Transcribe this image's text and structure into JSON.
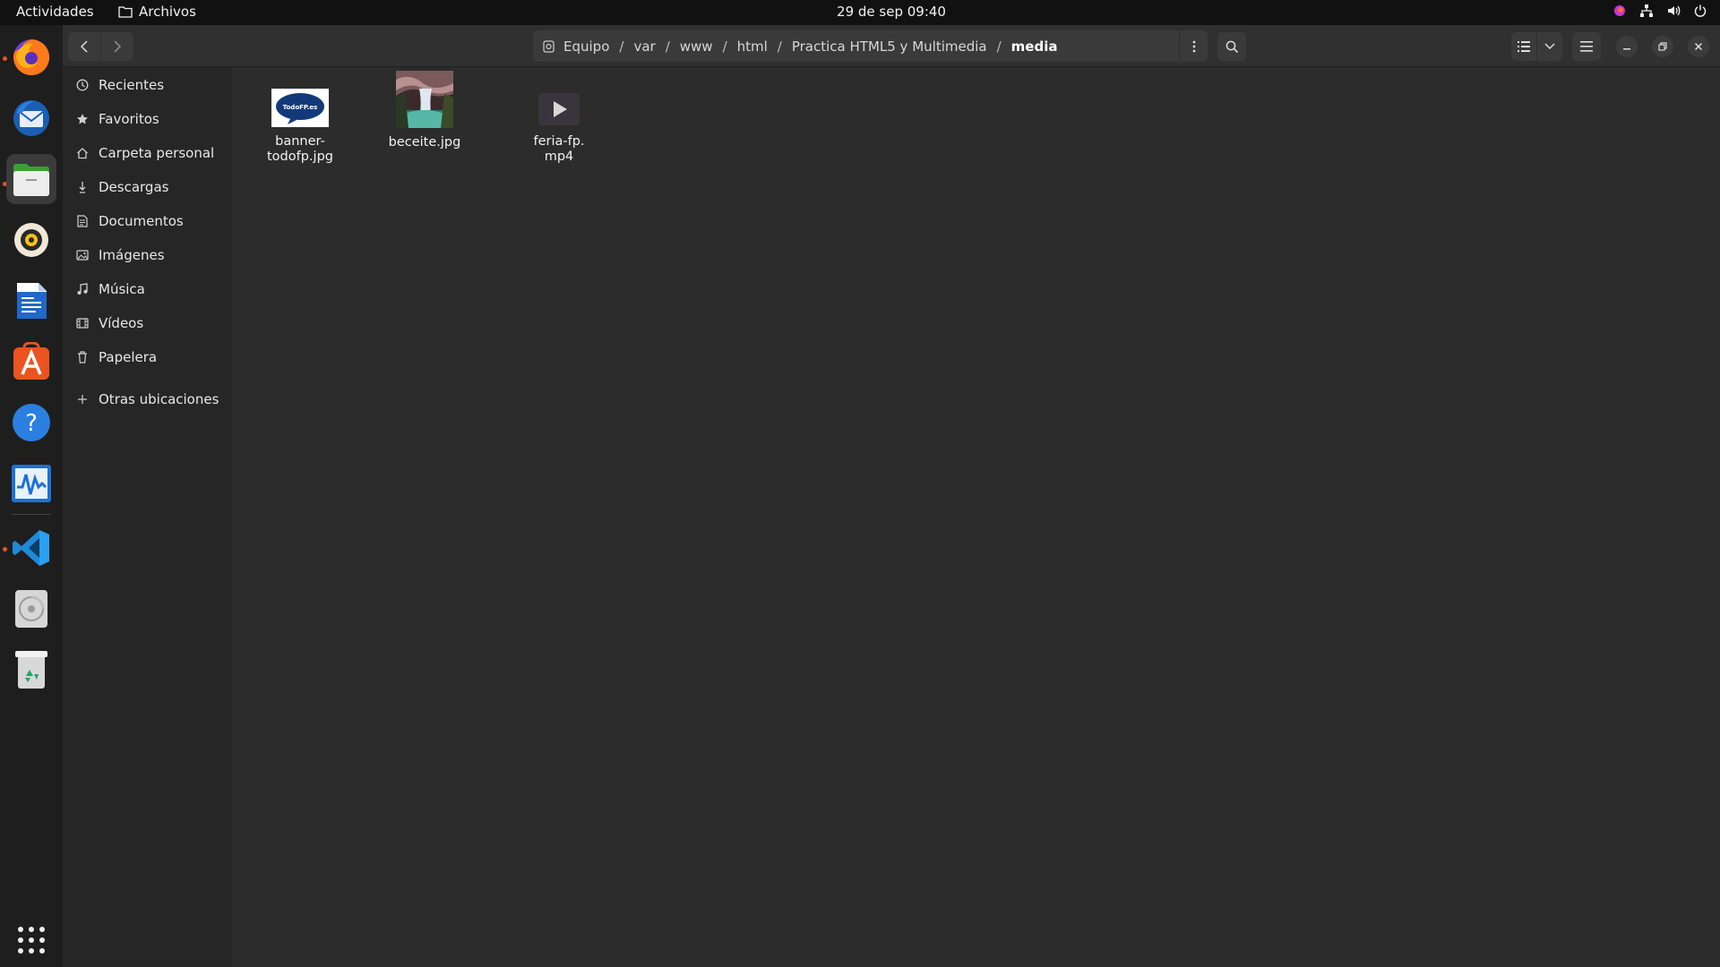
{
  "topbar": {
    "activities": "Actividades",
    "app_name": "Archivos",
    "clock": "29 de sep  09:40",
    "tray_icons": [
      "colorful-app-icon",
      "network-icon",
      "volume-icon",
      "power-icon"
    ]
  },
  "dock": {
    "items": [
      "firefox-icon",
      "thunderbird-icon",
      "files-icon",
      "rhythmbox-icon",
      "writer-icon",
      "app-center-icon",
      "help-icon",
      "system-monitor-icon",
      "vscode-icon",
      "disc-drive-icon",
      "trash-icon"
    ],
    "app_grid_icon": "app-grid-icon"
  },
  "path": {
    "segments": [
      "Equipo",
      "var",
      "www",
      "html",
      "Practica HTML5 y Multimedia",
      "media"
    ],
    "current": "media"
  },
  "sidebar": {
    "items": [
      {
        "label": "Recientes",
        "icon": "clock-icon"
      },
      {
        "label": "Favoritos",
        "icon": "star-icon"
      },
      {
        "label": "Carpeta personal",
        "icon": "home-icon"
      },
      {
        "label": "Descargas",
        "icon": "download-icon"
      },
      {
        "label": "Documentos",
        "icon": "document-icon"
      },
      {
        "label": "Imágenes",
        "icon": "image-icon"
      },
      {
        "label": "Música",
        "icon": "music-icon"
      },
      {
        "label": "Vídeos",
        "icon": "video-icon"
      },
      {
        "label": "Papelera",
        "icon": "trash-icon"
      },
      {
        "label": "Otras ubicaciones",
        "icon": "plus-icon"
      }
    ]
  },
  "files": [
    {
      "line1": "banner-",
      "line2": "todofp.jpg",
      "type": "image",
      "thumb_text": "TodoFP.es"
    },
    {
      "line1": "beceite.jpg",
      "line2": "",
      "type": "image"
    },
    {
      "line1": "feria-fp.",
      "line2": "mp4",
      "type": "video"
    }
  ],
  "colors": {
    "accent": "#e95420",
    "window_bg": "#2c2c2c",
    "sidebar_bg": "#262626",
    "topbar_bg": "#111111"
  }
}
